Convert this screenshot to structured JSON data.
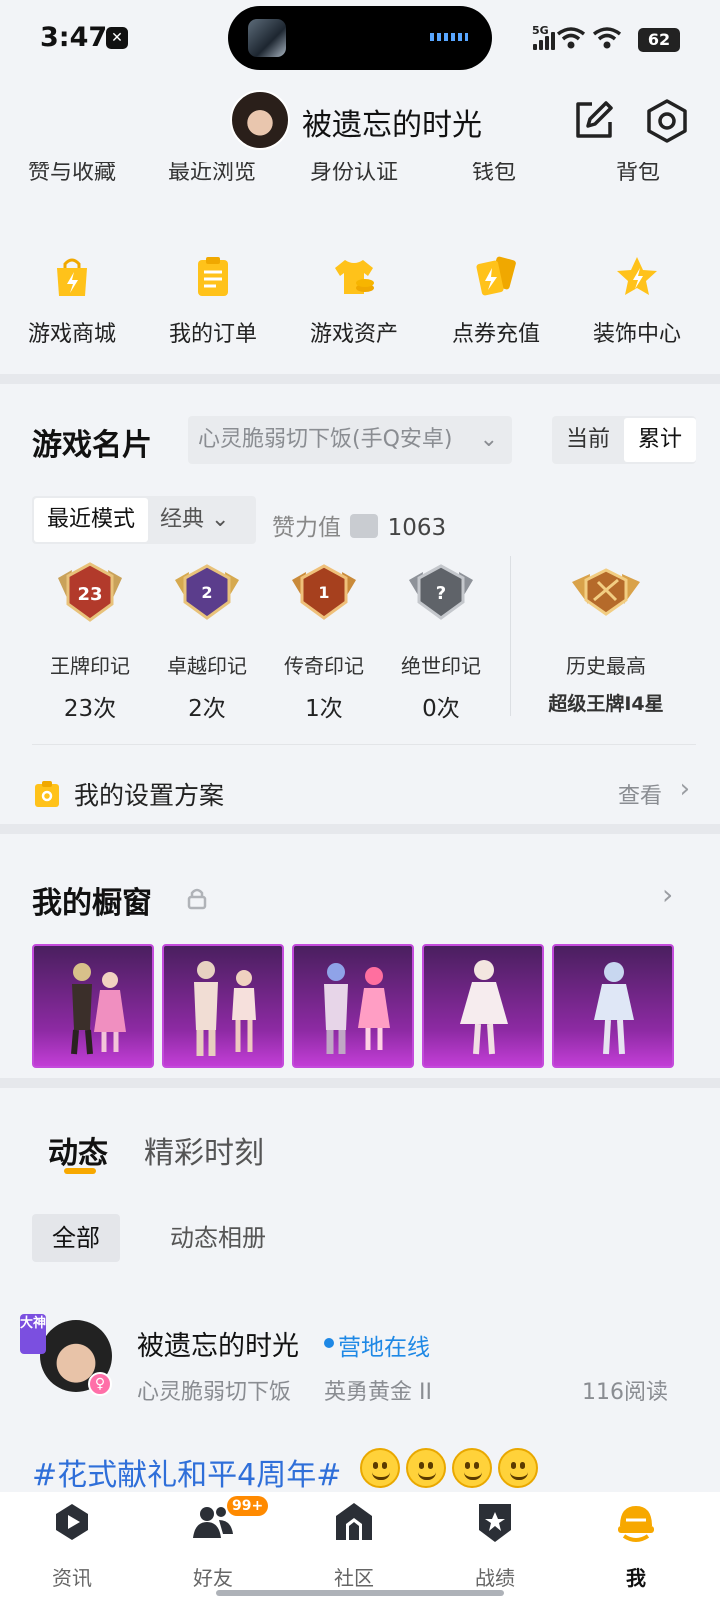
{
  "status_bar": {
    "time": "3:47",
    "signal_label": "5G",
    "battery": "62"
  },
  "header": {
    "username": "被遗忘的时光"
  },
  "cut_row": [
    "赞与收藏",
    "最近浏览",
    "身份认证",
    "钱包",
    "背包"
  ],
  "quick_actions": [
    {
      "label": "游戏商城",
      "icon": "shopping-bag-icon"
    },
    {
      "label": "我的订单",
      "icon": "order-list-icon"
    },
    {
      "label": "游戏资产",
      "icon": "tshirt-coins-icon"
    },
    {
      "label": "点券充值",
      "icon": "coupon-cards-icon"
    },
    {
      "label": "装饰中心",
      "icon": "star-decoration-icon"
    }
  ],
  "game_card": {
    "title": "游戏名片",
    "account": "心灵脆弱切下饭(手Q安卓)",
    "toggle": {
      "current": "当前",
      "total": "累计"
    },
    "mode": {
      "recent": "最近模式",
      "classic": "经典"
    },
    "zan_label": "赞力值",
    "zan_value": "1063",
    "badges": [
      {
        "label": "王牌印记",
        "value": "23次",
        "medal_num": "23"
      },
      {
        "label": "卓越印记",
        "value": "2次",
        "medal_num": "2"
      },
      {
        "label": "传奇印记",
        "value": "1次",
        "medal_num": "1"
      },
      {
        "label": "绝世印记",
        "value": "0次",
        "medal_num": "?"
      }
    ],
    "highest": {
      "label": "历史最高",
      "value": "超级王牌I4星"
    },
    "settings": {
      "label": "我的设置方案",
      "action": "查看"
    }
  },
  "showcase": {
    "title": "我的橱窗"
  },
  "feed": {
    "tabs": [
      "动态",
      "精彩时刻"
    ],
    "chips": [
      "全部",
      "动态相册"
    ],
    "post": {
      "badge": "大神",
      "name": "被遗忘的时光",
      "status": "营地在线",
      "server": "心灵脆弱切下饭",
      "rank": "英勇黄金 II",
      "reads": "116阅读",
      "hashtag": "#花式献礼和平4周年#"
    }
  },
  "bottom_nav": [
    {
      "label": "资讯",
      "icon": "news-play-icon"
    },
    {
      "label": "好友",
      "icon": "friends-icon",
      "badge": "99+"
    },
    {
      "label": "社区",
      "icon": "community-house-icon"
    },
    {
      "label": "战绩",
      "icon": "battle-record-icon"
    },
    {
      "label": "我",
      "icon": "helmet-me-icon"
    }
  ],
  "colors": {
    "accent": "#f7a800",
    "link": "#2f6fd9",
    "online": "#1e88e5",
    "skin_bg": "#8d2aa3"
  }
}
